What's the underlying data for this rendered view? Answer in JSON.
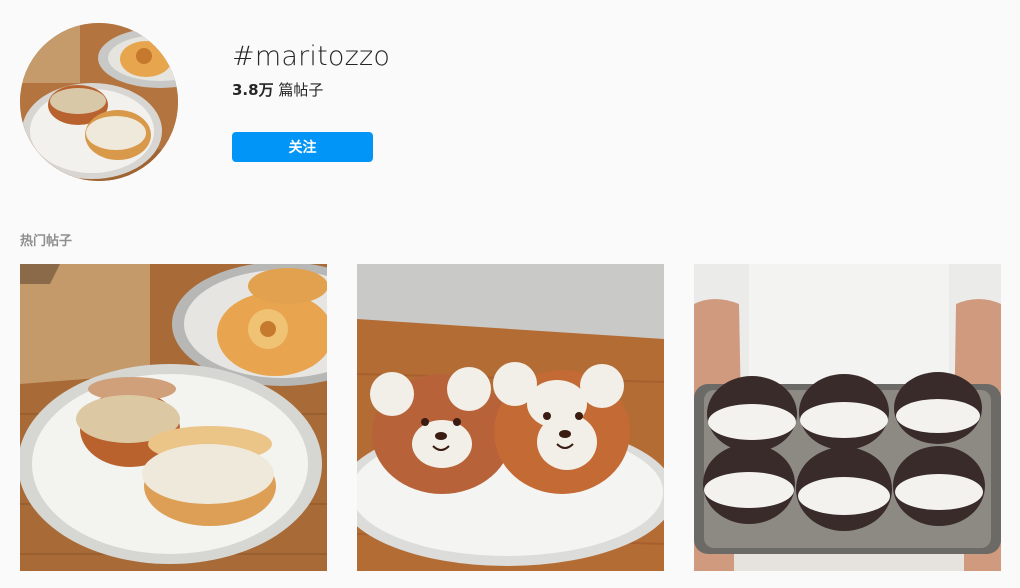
{
  "hashtag": {
    "title": "#maritozzo",
    "post_count_number": "3.8万",
    "post_count_suffix": "篇帖子",
    "follow_label": "关注"
  },
  "top_posts": {
    "label": "热门帖子",
    "posts": [
      {
        "subject": "Two cream-filled maritozzo buns on a white plate, pastry dish behind"
      },
      {
        "subject": "Two bear-face maritozzo buns on a white plate"
      },
      {
        "subject": "Tray of six chocolate maritozzo buns held by a person"
      }
    ]
  },
  "colors": {
    "accent": "#0095f6",
    "background": "#fafafa",
    "muted_text": "#8e8e8e"
  }
}
